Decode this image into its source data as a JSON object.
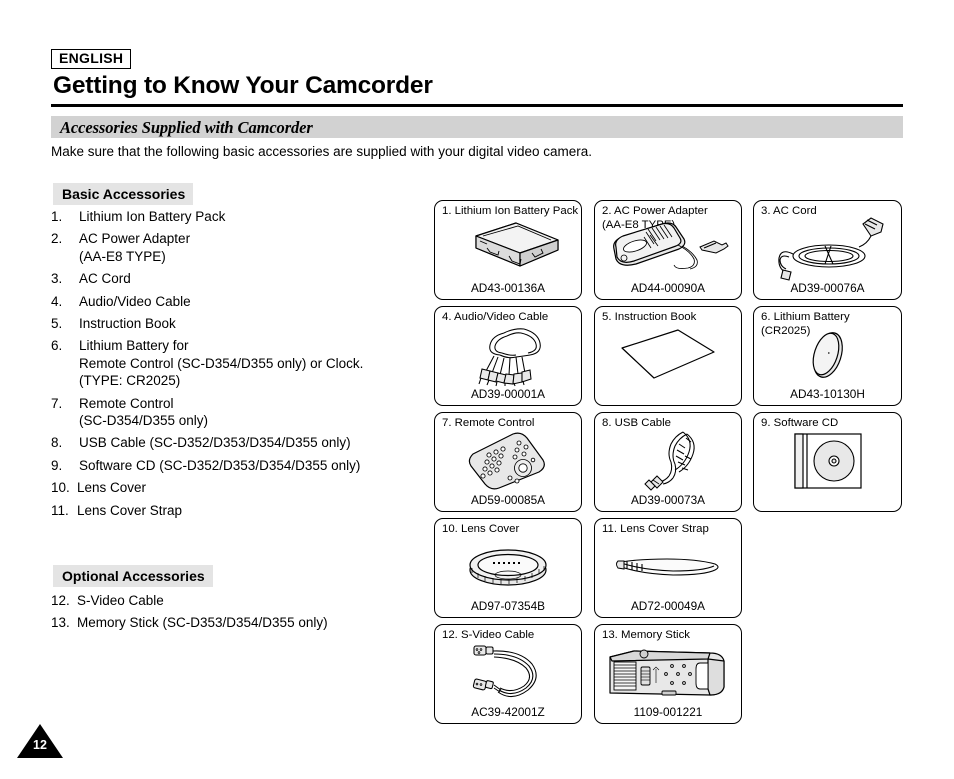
{
  "header": {
    "language_badge": "ENGLISH",
    "title": "Getting to Know Your Camcorder",
    "section_band": "Accessories Supplied with Camcorder",
    "intro": "Make sure that the following basic accessories are supplied with your digital video camera."
  },
  "basic": {
    "heading": "Basic Accessories",
    "items": [
      {
        "num": "1.",
        "lines": [
          "Lithium Ion Battery Pack"
        ]
      },
      {
        "num": "2.",
        "lines": [
          "AC Power Adapter",
          "(AA-E8 TYPE)"
        ]
      },
      {
        "num": "3.",
        "lines": [
          "AC Cord"
        ]
      },
      {
        "num": "4.",
        "lines": [
          "Audio/Video Cable"
        ]
      },
      {
        "num": "5.",
        "lines": [
          "Instruction Book"
        ]
      },
      {
        "num": "6.",
        "lines": [
          "Lithium Battery for",
          "Remote Control (SC-D354/D355 only) or Clock.",
          "(TYPE: CR2025)"
        ]
      },
      {
        "num": "7.",
        "lines": [
          "Remote Control",
          "(SC-D354/D355 only)"
        ]
      },
      {
        "num": "8.",
        "lines": [
          "USB Cable (SC-D352/D353/D354/D355 only)"
        ]
      },
      {
        "num": "9.",
        "lines": [
          "Software CD (SC-D352/D353/D354/D355 only)"
        ]
      },
      {
        "num": "10.",
        "lines": [
          "Lens Cover"
        ]
      },
      {
        "num": "11.",
        "lines": [
          "Lens Cover Strap"
        ]
      }
    ]
  },
  "optional": {
    "heading": "Optional Accessories",
    "items": [
      {
        "num": "12.",
        "lines": [
          "S-Video Cable"
        ]
      },
      {
        "num": "13.",
        "lines": [
          "Memory Stick (SC-D353/D354/D355 only)"
        ]
      }
    ]
  },
  "figures": [
    {
      "caption": "1. Lithium Ion Battery Pack",
      "part_no": "AD43-00136A",
      "art": "battery-pack"
    },
    {
      "caption": "2. AC Power Adapter\n(AA-E8 TYPE)",
      "part_no": "AD44-00090A",
      "art": "ac-adapter"
    },
    {
      "caption": "3. AC Cord",
      "part_no": "AD39-00076A",
      "art": "ac-cord"
    },
    {
      "caption": "4. Audio/Video Cable",
      "part_no": "AD39-00001A",
      "art": "av-cable"
    },
    {
      "caption": "5. Instruction Book",
      "part_no": "",
      "art": "instruction-book"
    },
    {
      "caption": "6. Lithium Battery\n(CR2025)",
      "part_no": "AD43-10130H",
      "art": "coin-battery"
    },
    {
      "caption": "7. Remote Control",
      "part_no": "AD59-00085A",
      "art": "remote-control"
    },
    {
      "caption": "8. USB Cable",
      "part_no": "AD39-00073A",
      "art": "usb-cable"
    },
    {
      "caption": "9. Software CD",
      "part_no": "",
      "art": "software-cd"
    },
    {
      "caption": "10. Lens Cover",
      "part_no": "AD97-07354B",
      "art": "lens-cover"
    },
    {
      "caption": "11. Lens Cover Strap",
      "part_no": "AD72-00049A",
      "art": "lens-cover-strap"
    },
    {
      "caption": "12. S-Video Cable",
      "part_no": "AC39-42001Z",
      "art": "s-video-cable"
    },
    {
      "caption": "13. Memory Stick",
      "part_no": "1109-001221",
      "art": "memory-stick"
    }
  ],
  "footer": {
    "page_number": "12"
  },
  "colors": {
    "band_gray": "#d2d2d2",
    "subhead_gray": "#e4e4e4",
    "ink": "#000000",
    "art_fill": "#e8e8e8"
  }
}
